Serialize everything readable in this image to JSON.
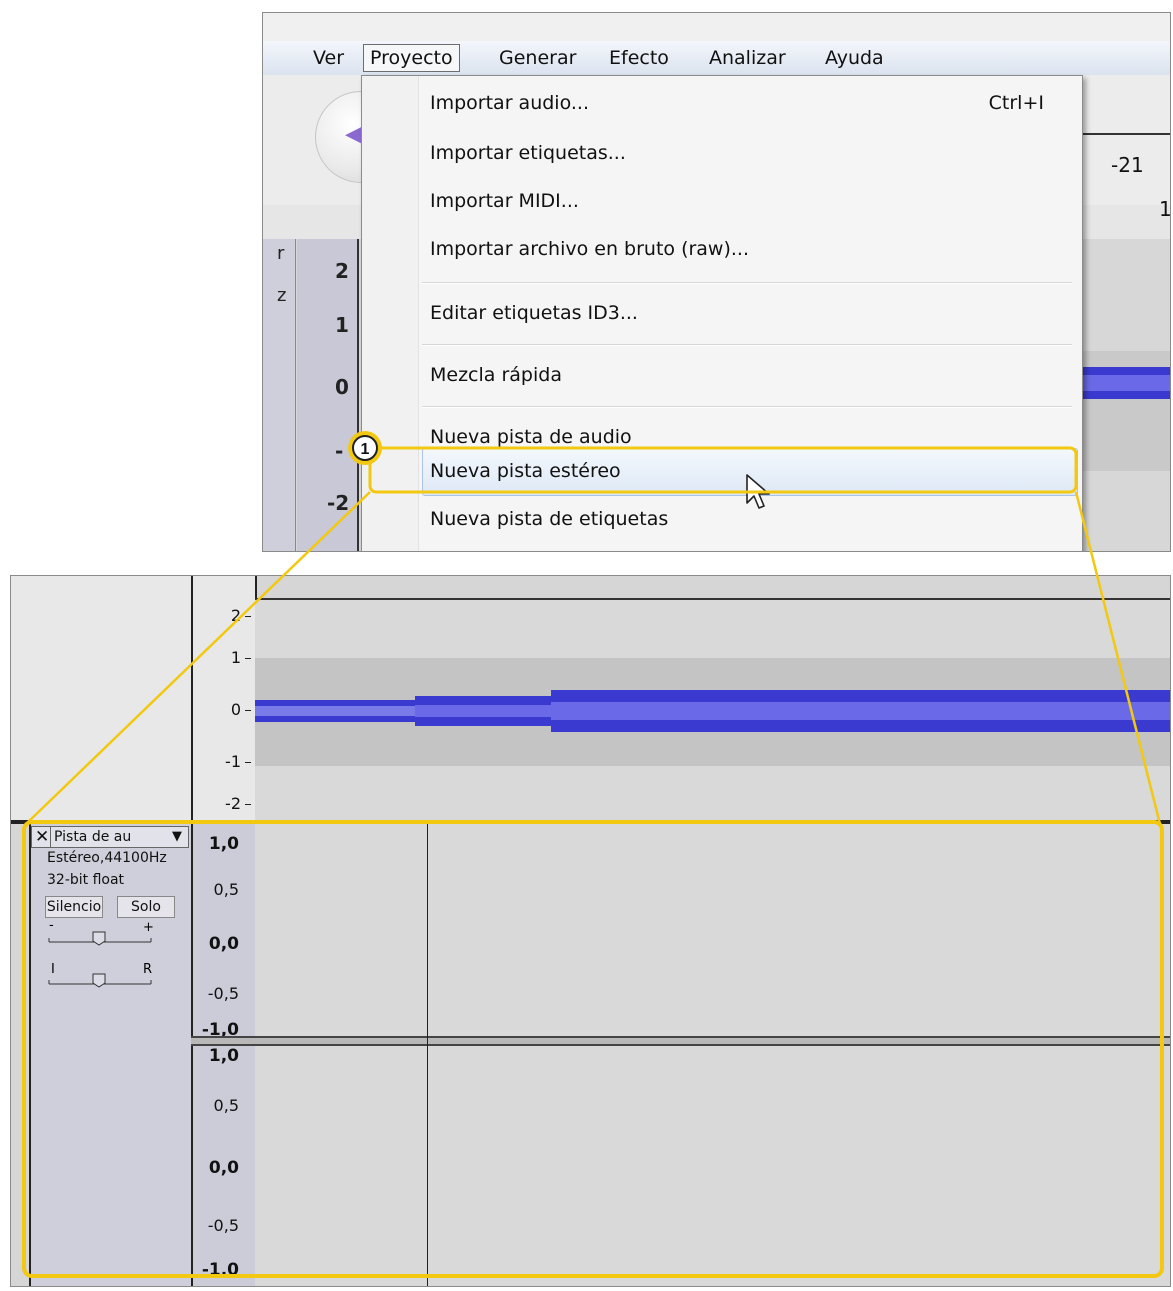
{
  "menubar": {
    "items": [
      {
        "label": "Ver",
        "active": false
      },
      {
        "label": "Proyecto",
        "active": true
      },
      {
        "label": "Generar",
        "active": false
      },
      {
        "label": "Efecto",
        "active": false
      },
      {
        "label": "Analizar",
        "active": false
      },
      {
        "label": "Ayuda",
        "active": false
      }
    ]
  },
  "top_partial": {
    "level_readout": "-21",
    "ruler_value": "1",
    "scale_labels": [
      "2",
      "1",
      "0",
      "-",
      "-2"
    ],
    "side_letter_1": "r",
    "side_letter_2": "z"
  },
  "dropdown": {
    "items": [
      {
        "label": "Importar audio...",
        "shortcut": "Ctrl+I"
      },
      {
        "label": "Importar etiquetas...",
        "shortcut": ""
      },
      {
        "label": "Importar MIDI...",
        "shortcut": ""
      },
      {
        "label": "Importar archivo en bruto (raw)...",
        "shortcut": ""
      },
      {
        "label": "Editar etiquetas ID3...",
        "shortcut": ""
      },
      {
        "label": "Mezcla rápida",
        "shortcut": ""
      },
      {
        "label": "Nueva pista de audio",
        "shortcut": ""
      },
      {
        "label": "Nueva pista estéreo",
        "shortcut": "",
        "highlighted": true
      },
      {
        "label": "Nueva pista de etiquetas",
        "shortcut": ""
      }
    ]
  },
  "callout": {
    "number": "1",
    "color": "#f2c811"
  },
  "bottom": {
    "top_track_scale": [
      "2",
      "1",
      "0",
      "-1",
      "-2"
    ],
    "new_track": {
      "name": "Pista de au",
      "close_glyph": "✕",
      "menu_glyph": "▼",
      "format": "Estéreo,44100Hz",
      "bit_depth": "32-bit float",
      "mute_label": "Silencio",
      "solo_label": "Solo",
      "gain_minus": "-",
      "gain_plus": "+",
      "pan_left": "I",
      "pan_right": "R",
      "channel_scale": [
        "1,0",
        "0,5",
        "0,0",
        "-0,5",
        "-1,0"
      ]
    }
  },
  "colors": {
    "waveform": "#3a3ad0",
    "waveform_light": "#6a6ae8",
    "accent_yellow": "#f2c811"
  }
}
